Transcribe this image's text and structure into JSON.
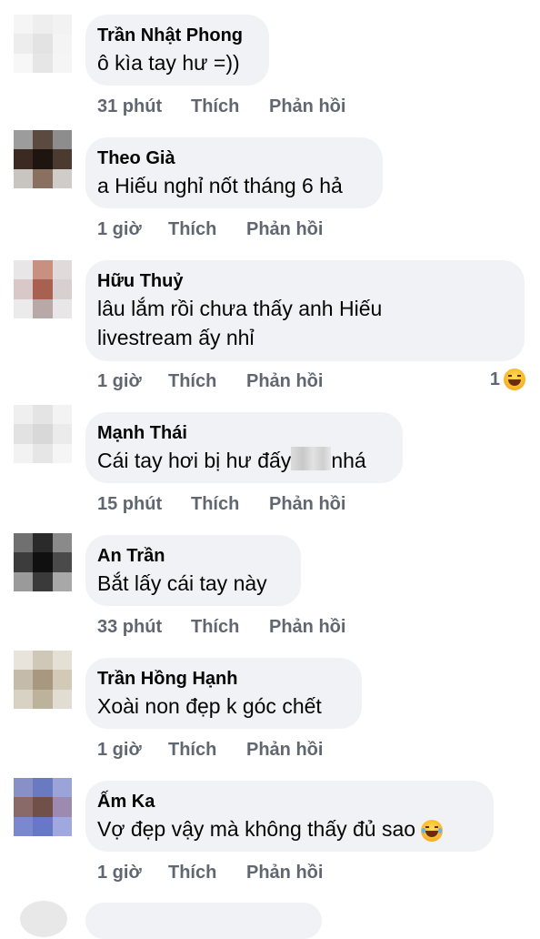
{
  "action_labels": {
    "like": "Thích",
    "reply": "Phản hồi"
  },
  "comments": [
    {
      "author": "Trần Nhật Phong",
      "lines": [
        "ô kìa tay hư =))"
      ],
      "time": "31 phút",
      "avatar_colors": [
        "#f5f5f5",
        "#eeeeee",
        "#f2f2f2",
        "#ededed",
        "#e3e3e3",
        "#f4f4f4",
        "#f7f7f7",
        "#e6e6e6",
        "#f5f5f5"
      ]
    },
    {
      "author": "Theo Già",
      "lines": [
        "a Hiếu nghỉ nốt tháng 6 hả"
      ],
      "time": "1 giờ",
      "avatar_colors": [
        "#9c9c9c",
        "#5a4a40",
        "#8d8d8d",
        "#3a2a22",
        "#1e1410",
        "#4a3a30",
        "#c8c4c0",
        "#8a7060",
        "#d0ccc8"
      ]
    },
    {
      "author": "Hữu Thuỷ",
      "lines": [
        "lâu lắm rồi chưa thấy anh Hiếu",
        "livestream ấy nhỉ"
      ],
      "time": "1 giờ",
      "reaction": {
        "count": "1",
        "icon": "laughing-emoji-icon"
      },
      "avatar_colors": [
        "#e8e6e6",
        "#c89080",
        "#e0dada",
        "#d8c8c8",
        "#a86050",
        "#d8d0d0",
        "#ecebeb",
        "#b8a8a8",
        "#e8e6e6"
      ]
    },
    {
      "author": "Mạnh Thái",
      "lines": [
        "Cái tay hơi bị hư đấy",
        "nhá"
      ],
      "time": "15 phút",
      "censored": true,
      "avatar_colors": [
        "#efefef",
        "#e4e4e4",
        "#f3f3f3",
        "#e2e2e2",
        "#d8d8d8",
        "#ebebeb",
        "#f2f2f2",
        "#e6e6e6",
        "#f5f5f5"
      ]
    },
    {
      "author": "An Trần",
      "lines": [
        "Bắt lấy cái tay này"
      ],
      "time": "33 phút",
      "avatar_colors": [
        "#707070",
        "#2a2a2a",
        "#8a8a8a",
        "#3c3c3c",
        "#101010",
        "#4a4a4a",
        "#9a9a9a",
        "#3a3a3a",
        "#a8a8a8"
      ]
    },
    {
      "author": "Trần Hồng Hạnh",
      "lines": [
        "Xoài non đẹp k góc chết"
      ],
      "time": "1 giờ",
      "avatar_colors": [
        "#e8e4dc",
        "#cfc7b8",
        "#e5e0d6",
        "#c4bba8",
        "#a89880",
        "#d2c9b7",
        "#d8d2c4",
        "#bdb29c",
        "#e2ddd2"
      ]
    },
    {
      "author": "Ấm Ka",
      "lines": [
        "Vợ đẹp vậy mà không thấy đủ sao"
      ],
      "time": "1 giờ",
      "emoji": "crying-laughing-emoji-icon",
      "avatar_colors": [
        "#8890c8",
        "#6a7ac0",
        "#9aa4d8",
        "#8a6a68",
        "#705048",
        "#9c8ab0",
        "#7a88d0",
        "#6878c8",
        "#a0a8e0"
      ]
    }
  ]
}
